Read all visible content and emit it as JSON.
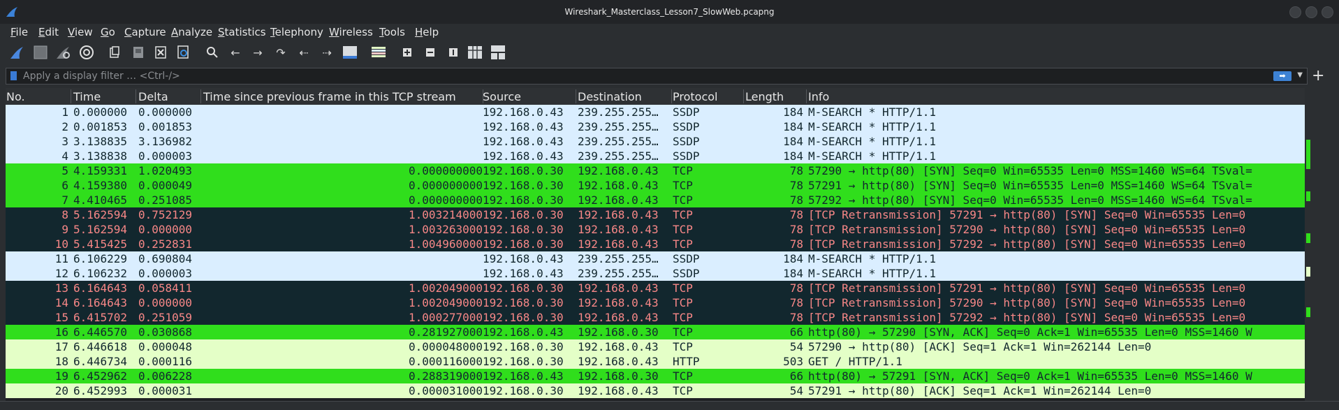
{
  "window": {
    "title": "Wireshark_Masterclass_Lesson7_SlowWeb.pcapng"
  },
  "menu": [
    "File",
    "Edit",
    "View",
    "Go",
    "Capture",
    "Analyze",
    "Statistics",
    "Telephony",
    "Wireless",
    "Tools",
    "Help"
  ],
  "toolbar_icons": [
    "shark-fin-start-icon",
    "stop-capture-icon",
    "restart-capture-icon",
    "capture-options-icon",
    "open-file-icon",
    "save-file-icon",
    "close-file-icon",
    "reload-file-icon",
    "find-packet-icon",
    "go-back-icon",
    "go-forward-icon",
    "go-to-packet-icon",
    "go-first-icon",
    "go-last-icon",
    "autoscroll-icon",
    "colorize-icon",
    "zoom-in-icon",
    "zoom-out-icon",
    "normal-size-icon",
    "resize-columns-icon",
    "layout-icon"
  ],
  "filter": {
    "placeholder": "Apply a display filter … <Ctrl-/>"
  },
  "columns": [
    "No.",
    "Time",
    "Delta",
    "Time since previous frame in this TCP stream",
    "Source",
    "Destination",
    "Protocol",
    "Length",
    "Info"
  ],
  "colors": {
    "ssdp_bg": "#daeeff",
    "syn_bg": "#30de1c",
    "bad_bg": "#12272e",
    "bad_fg": "#f78787",
    "http_bg": "#e4ffc7",
    "text_dark": "#12272e"
  },
  "packets": [
    {
      "no": "1",
      "time": "0.000000",
      "delta": "0.000000",
      "tcpdelta": "",
      "src": "192.168.0.43",
      "dst": "239.255.255…",
      "proto": "SSDP",
      "len": "184",
      "info": "M-SEARCH * HTTP/1.1",
      "style": "ssdp"
    },
    {
      "no": "2",
      "time": "0.001853",
      "delta": "0.001853",
      "tcpdelta": "",
      "src": "192.168.0.43",
      "dst": "239.255.255…",
      "proto": "SSDP",
      "len": "184",
      "info": "M-SEARCH * HTTP/1.1",
      "style": "ssdp"
    },
    {
      "no": "3",
      "time": "3.138835",
      "delta": "3.136982",
      "tcpdelta": "",
      "src": "192.168.0.43",
      "dst": "239.255.255…",
      "proto": "SSDP",
      "len": "184",
      "info": "M-SEARCH * HTTP/1.1",
      "style": "ssdp"
    },
    {
      "no": "4",
      "time": "3.138838",
      "delta": "0.000003",
      "tcpdelta": "",
      "src": "192.168.0.43",
      "dst": "239.255.255…",
      "proto": "SSDP",
      "len": "184",
      "info": "M-SEARCH * HTTP/1.1",
      "style": "ssdp"
    },
    {
      "no": "5",
      "time": "4.159331",
      "delta": "1.020493",
      "tcpdelta": "0.000000000",
      "src": "192.168.0.30",
      "dst": "192.168.0.43",
      "proto": "TCP",
      "len": "78",
      "info": "57290 → http(80) [SYN] Seq=0 Win=65535 Len=0 MSS=1460 WS=64 TSval=",
      "style": "syn"
    },
    {
      "no": "6",
      "time": "4.159380",
      "delta": "0.000049",
      "tcpdelta": "0.000000000",
      "src": "192.168.0.30",
      "dst": "192.168.0.43",
      "proto": "TCP",
      "len": "78",
      "info": "57291 → http(80) [SYN] Seq=0 Win=65535 Len=0 MSS=1460 WS=64 TSval=",
      "style": "syn"
    },
    {
      "no": "7",
      "time": "4.410465",
      "delta": "0.251085",
      "tcpdelta": "0.000000000",
      "src": "192.168.0.30",
      "dst": "192.168.0.43",
      "proto": "TCP",
      "len": "78",
      "info": "57292 → http(80) [SYN] Seq=0 Win=65535 Len=0 MSS=1460 WS=64 TSval=",
      "style": "syn"
    },
    {
      "no": "8",
      "time": "5.162594",
      "delta": "0.752129",
      "tcpdelta": "1.003214000",
      "src": "192.168.0.30",
      "dst": "192.168.0.43",
      "proto": "TCP",
      "len": "78",
      "info": "[TCP Retransmission] 57291 → http(80) [SYN] Seq=0 Win=65535 Len=0",
      "style": "bad"
    },
    {
      "no": "9",
      "time": "5.162594",
      "delta": "0.000000",
      "tcpdelta": "1.003263000",
      "src": "192.168.0.30",
      "dst": "192.168.0.43",
      "proto": "TCP",
      "len": "78",
      "info": "[TCP Retransmission] 57290 → http(80) [SYN] Seq=0 Win=65535 Len=0",
      "style": "bad"
    },
    {
      "no": "10",
      "time": "5.415425",
      "delta": "0.252831",
      "tcpdelta": "1.004960000",
      "src": "192.168.0.30",
      "dst": "192.168.0.43",
      "proto": "TCP",
      "len": "78",
      "info": "[TCP Retransmission] 57292 → http(80) [SYN] Seq=0 Win=65535 Len=0",
      "style": "bad"
    },
    {
      "no": "11",
      "time": "6.106229",
      "delta": "0.690804",
      "tcpdelta": "",
      "src": "192.168.0.43",
      "dst": "239.255.255…",
      "proto": "SSDP",
      "len": "184",
      "info": "M-SEARCH * HTTP/1.1",
      "style": "ssdp"
    },
    {
      "no": "12",
      "time": "6.106232",
      "delta": "0.000003",
      "tcpdelta": "",
      "src": "192.168.0.43",
      "dst": "239.255.255…",
      "proto": "SSDP",
      "len": "184",
      "info": "M-SEARCH * HTTP/1.1",
      "style": "ssdp"
    },
    {
      "no": "13",
      "time": "6.164643",
      "delta": "0.058411",
      "tcpdelta": "1.002049000",
      "src": "192.168.0.30",
      "dst": "192.168.0.43",
      "proto": "TCP",
      "len": "78",
      "info": "[TCP Retransmission] 57291 → http(80) [SYN] Seq=0 Win=65535 Len=0",
      "style": "bad"
    },
    {
      "no": "14",
      "time": "6.164643",
      "delta": "0.000000",
      "tcpdelta": "1.002049000",
      "src": "192.168.0.30",
      "dst": "192.168.0.43",
      "proto": "TCP",
      "len": "78",
      "info": "[TCP Retransmission] 57290 → http(80) [SYN] Seq=0 Win=65535 Len=0",
      "style": "bad"
    },
    {
      "no": "15",
      "time": "6.415702",
      "delta": "0.251059",
      "tcpdelta": "1.000277000",
      "src": "192.168.0.30",
      "dst": "192.168.0.43",
      "proto": "TCP",
      "len": "78",
      "info": "[TCP Retransmission] 57292 → http(80) [SYN] Seq=0 Win=65535 Len=0",
      "style": "bad"
    },
    {
      "no": "16",
      "time": "6.446570",
      "delta": "0.030868",
      "tcpdelta": "0.281927000",
      "src": "192.168.0.43",
      "dst": "192.168.0.30",
      "proto": "TCP",
      "len": "66",
      "info": "http(80) → 57290 [SYN, ACK] Seq=0 Ack=1 Win=65535 Len=0 MSS=1460 W",
      "style": "syn"
    },
    {
      "no": "17",
      "time": "6.446618",
      "delta": "0.000048",
      "tcpdelta": "0.000048000",
      "src": "192.168.0.30",
      "dst": "192.168.0.43",
      "proto": "TCP",
      "len": "54",
      "info": "57290 → http(80) [ACK] Seq=1 Ack=1 Win=262144 Len=0",
      "style": "http"
    },
    {
      "no": "18",
      "time": "6.446734",
      "delta": "0.000116",
      "tcpdelta": "0.000116000",
      "src": "192.168.0.30",
      "dst": "192.168.0.43",
      "proto": "HTTP",
      "len": "503",
      "info": "GET / HTTP/1.1",
      "style": "http"
    },
    {
      "no": "19",
      "time": "6.452962",
      "delta": "0.006228",
      "tcpdelta": "0.288319000",
      "src": "192.168.0.43",
      "dst": "192.168.0.30",
      "proto": "TCP",
      "len": "66",
      "info": "http(80) → 57291 [SYN, ACK] Seq=0 Ack=1 Win=65535 Len=0 MSS=1460 W",
      "style": "syn"
    },
    {
      "no": "20",
      "time": "6.452993",
      "delta": "0.000031",
      "tcpdelta": "0.000031000",
      "src": "192.168.0.30",
      "dst": "192.168.0.43",
      "proto": "TCP",
      "len": "54",
      "info": "57291 → http(80) [ACK] Seq=1 Ack=1 Win=262144 Len=0",
      "style": "http"
    }
  ]
}
